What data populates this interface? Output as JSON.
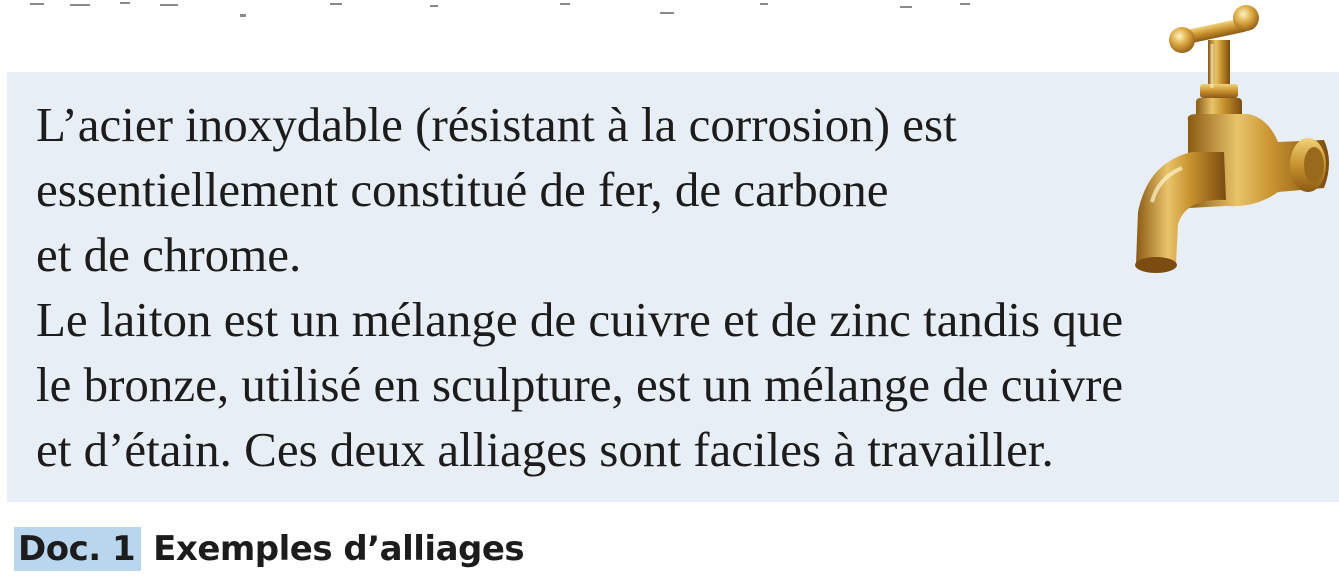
{
  "document": {
    "lines": [
      "L’acier inoxydable (résistant à la corrosion) est",
      "essentiellement constitué de fer, de carbone",
      "et de chrome.",
      "Le laiton est un mélange de cuivre et de zinc tandis que",
      "le bronze, utilisé en sculpture, est un mélange de cuivre",
      "et d’étain. Ces deux alliages sont faciles à travailler."
    ],
    "image": "brass-faucet",
    "box_color": "#e7eef6"
  },
  "caption": {
    "badge": "Doc. 1",
    "title": "Exemples d’alliages",
    "badge_color": "#b9d6ee"
  }
}
